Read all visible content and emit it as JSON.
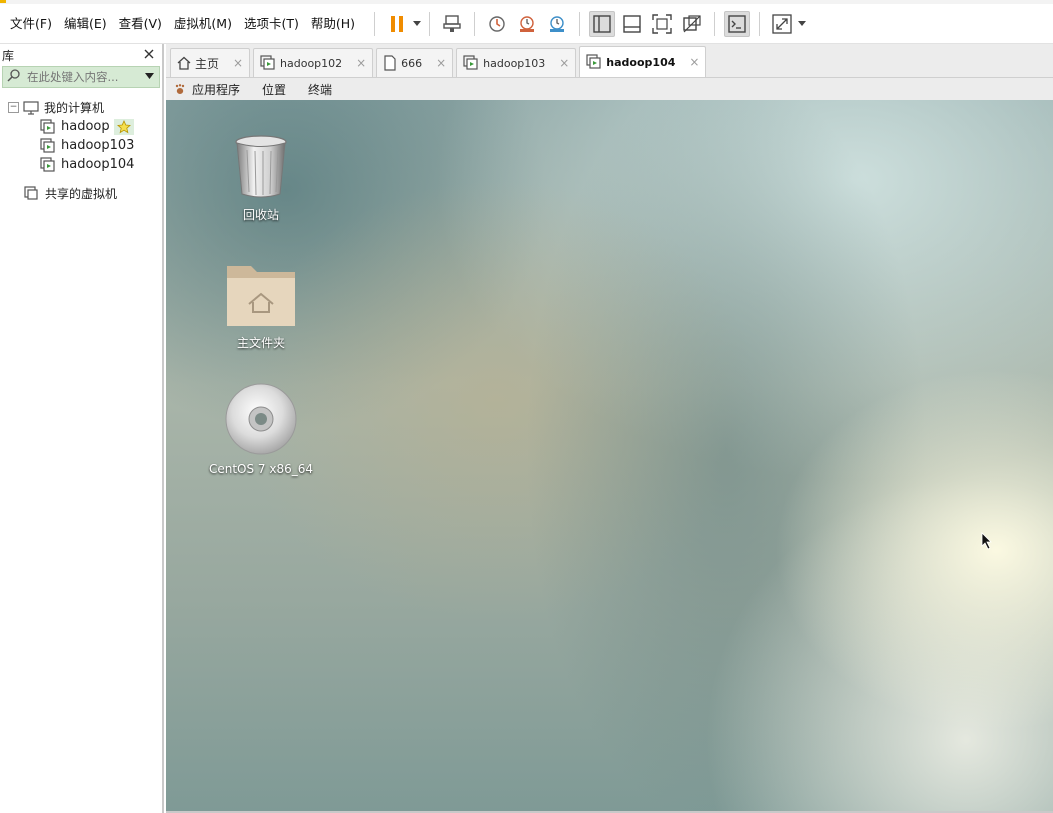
{
  "menu": {
    "file": "文件(F)",
    "edit": "编辑(E)",
    "view": "查看(V)",
    "vm": "虚拟机(M)",
    "tabs": "选项卡(T)",
    "help": "帮助(H)"
  },
  "toolbar": {
    "icons": [
      "pause-icon",
      "send-ctrl-alt-del-icon",
      "snapshot-icon",
      "revert-snapshot-icon",
      "snapshot-manager-icon",
      "show-library-icon",
      "thumbnail-bar-icon",
      "full-screen-icon",
      "unity-icon",
      "console-icon",
      "stretch-icon"
    ],
    "colors": {
      "pause": "#f08c00",
      "snapshot": "#d0623c"
    }
  },
  "library": {
    "title": "库",
    "search_placeholder": "在此处键入内容...",
    "my_computer": "我的计算机",
    "vms": [
      "hadoop",
      "hadoop103",
      "hadoop104"
    ],
    "shared": "共享的虚拟机"
  },
  "tabs": [
    {
      "label": "主页",
      "icon": "home-icon"
    },
    {
      "label": "hadoop102",
      "icon": "vm-icon"
    },
    {
      "label": "666",
      "icon": "page-icon"
    },
    {
      "label": "hadoop103",
      "icon": "vm-icon"
    },
    {
      "label": "hadoop104",
      "icon": "vm-icon",
      "active": true
    }
  ],
  "guest": {
    "apps": "应用程序",
    "places": "位置",
    "terminal": "终端",
    "desktop_icons": [
      {
        "label": "回收站",
        "icon": "trash-icon"
      },
      {
        "label": "主文件夹",
        "icon": "home-folder-icon"
      },
      {
        "label": "CentOS 7 x86_64",
        "icon": "cd-icon"
      }
    ]
  }
}
